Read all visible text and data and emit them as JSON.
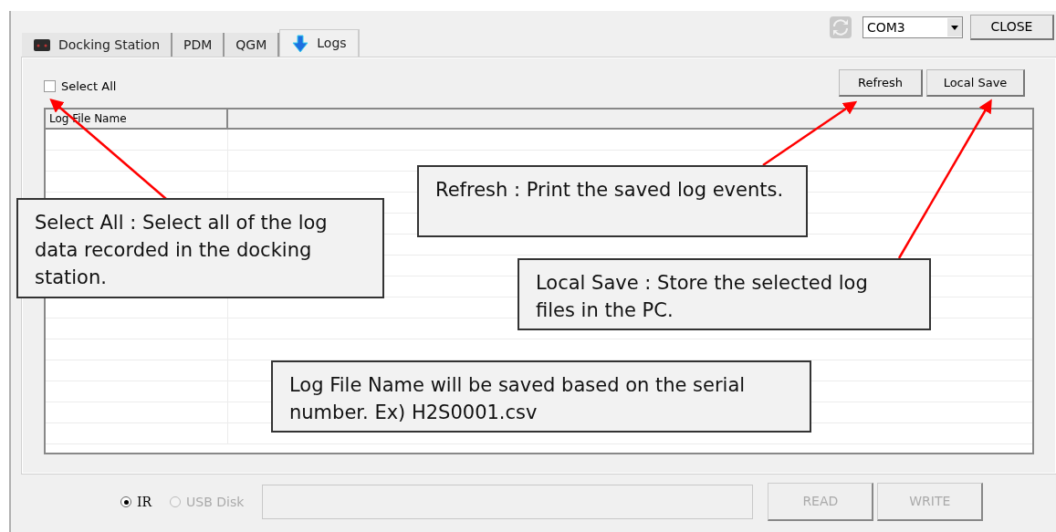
{
  "tabs": [
    {
      "label": "Docking Station",
      "kind": "device",
      "selected": false
    },
    {
      "label": "PDM",
      "kind": "plain",
      "selected": false
    },
    {
      "label": "QGM",
      "kind": "plain",
      "selected": false
    },
    {
      "label": "Logs",
      "kind": "download",
      "selected": true
    }
  ],
  "port": {
    "value": "COM3"
  },
  "close_button": "CLOSE",
  "select_all": {
    "label": "Select All",
    "checked": false
  },
  "buttons": [
    "Refresh",
    "Local Save"
  ],
  "table": {
    "columns": [
      "Log File Name"
    ]
  },
  "modes": [
    {
      "label": "IR",
      "selected": true,
      "disabled": false
    },
    {
      "label": "USB Disk",
      "selected": false,
      "disabled": true
    }
  ],
  "actions": [
    {
      "label": "READ",
      "disabled": true
    },
    {
      "label": "WRITE",
      "disabled": true
    }
  ],
  "callouts": [
    {
      "text": "Select All : Select all of the log data recorded in the docking station.",
      "kind": "arrow"
    },
    {
      "text": "Refresh : Print the saved log events.",
      "kind": "arrow"
    },
    {
      "text": "Local Save : Store the selected log files in the PC.",
      "kind": "arrow"
    },
    {
      "text": "Log File Name will be saved based on the serial number. Ex) H2S0001.csv",
      "kind": "plain"
    }
  ]
}
